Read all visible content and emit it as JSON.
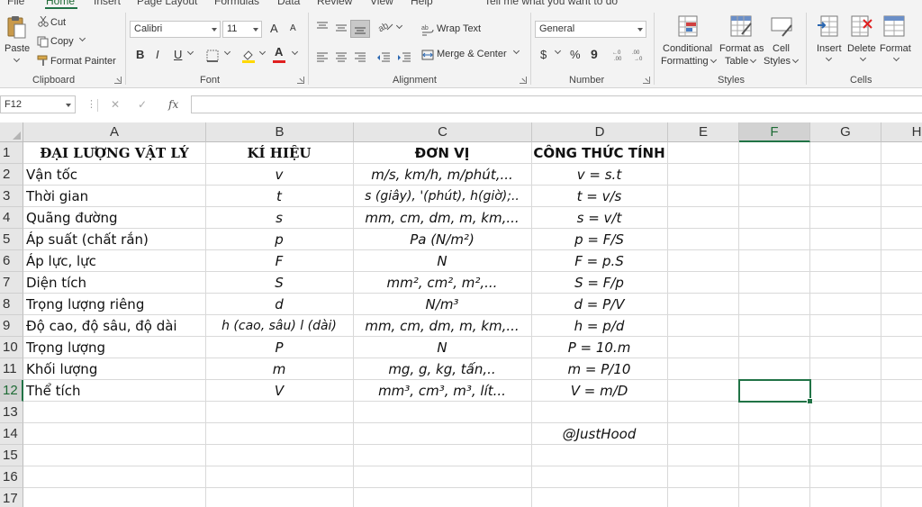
{
  "ribbon": {
    "tabs": [
      "File",
      "Home",
      "Insert",
      "Page Layout",
      "Formulas",
      "Data",
      "Review",
      "View",
      "Help",
      "Tell me what you want to do"
    ],
    "clipboard": {
      "paste": "Paste",
      "cut": "Cut",
      "copy": "Copy",
      "format_painter": "Format Painter",
      "label": "Clipboard"
    },
    "font": {
      "name": "Calibri",
      "size": "11",
      "bold": "B",
      "italic": "I",
      "underline": "U",
      "grow": "A",
      "shrink": "A",
      "font_color_letter": "A",
      "label": "Font"
    },
    "alignment": {
      "wrap_text": "Wrap Text",
      "merge_center": "Merge & Center",
      "label": "Alignment"
    },
    "number": {
      "format": "General",
      "currency": "$",
      "percent": "%",
      "comma": "9",
      "label": "Number"
    },
    "styles": {
      "conditional": "Conditional",
      "formatting": "Formatting",
      "format_as": "Format as",
      "table": "Table",
      "cell": "Cell",
      "cell_styles": "Styles",
      "label": "Styles"
    },
    "cells": {
      "insert": "Insert",
      "delete": "Delete",
      "format": "Format",
      "label": "Cells"
    }
  },
  "formula_bar": {
    "name_box": "F12",
    "cancel": "✕",
    "enter": "✓",
    "fx": "fx",
    "value": ""
  },
  "grid": {
    "columns": [
      "A",
      "B",
      "C",
      "D",
      "E",
      "F",
      "G",
      "H"
    ],
    "rows": [
      "1",
      "2",
      "3",
      "4",
      "5",
      "6",
      "7",
      "8",
      "9",
      "10",
      "11",
      "12",
      "13",
      "14",
      "15",
      "16",
      "17"
    ],
    "selected_cell": "F12",
    "header_row": [
      "ĐẠI LƯỢNG VẬT LÝ",
      "KÍ HIỆU",
      "ĐƠN VỊ",
      "CÔNG THỨC TÍNH"
    ],
    "data": [
      [
        "Vận tốc",
        "v",
        "m/s, km/h, m/phút,...",
        "v = s.t"
      ],
      [
        "Thời gian",
        "t",
        "s (giây), '(phút), h(giờ);..",
        "t = v/s"
      ],
      [
        "Quãng đường",
        "s",
        "mm, cm, dm, m, km,...",
        "s = v/t"
      ],
      [
        "Áp suất (chất rắn)",
        "p",
        "Pa (N/m²)",
        "p = F/S"
      ],
      [
        "Áp lực, lực",
        "F",
        "N",
        "F = p.S"
      ],
      [
        "Diện tích",
        "S",
        "mm², cm², m²,...",
        "S = F/p"
      ],
      [
        "Trọng lượng riêng",
        "d",
        "N/m³",
        "d = P/V"
      ],
      [
        "Độ cao, độ sâu, độ dài",
        "h (cao, sâu) l (dài)",
        "mm, cm, dm, m, km,...",
        "h = p/d"
      ],
      [
        "Trọng lượng",
        "P",
        "N",
        "P = 10.m"
      ],
      [
        "Khối lượng",
        "m",
        "mg, g, kg, tấn,..",
        "m = P/10"
      ],
      [
        "Thể tích",
        "V",
        "mm³, cm³, m³, lít...",
        "V = m/D"
      ]
    ],
    "signature": "@JustHood"
  },
  "colors": {
    "accent": "#217346",
    "ribbon_bg": "#f3f3f3",
    "header_bg": "#e6e6e6",
    "red": "#e02020",
    "yellow": "#ffd800"
  }
}
